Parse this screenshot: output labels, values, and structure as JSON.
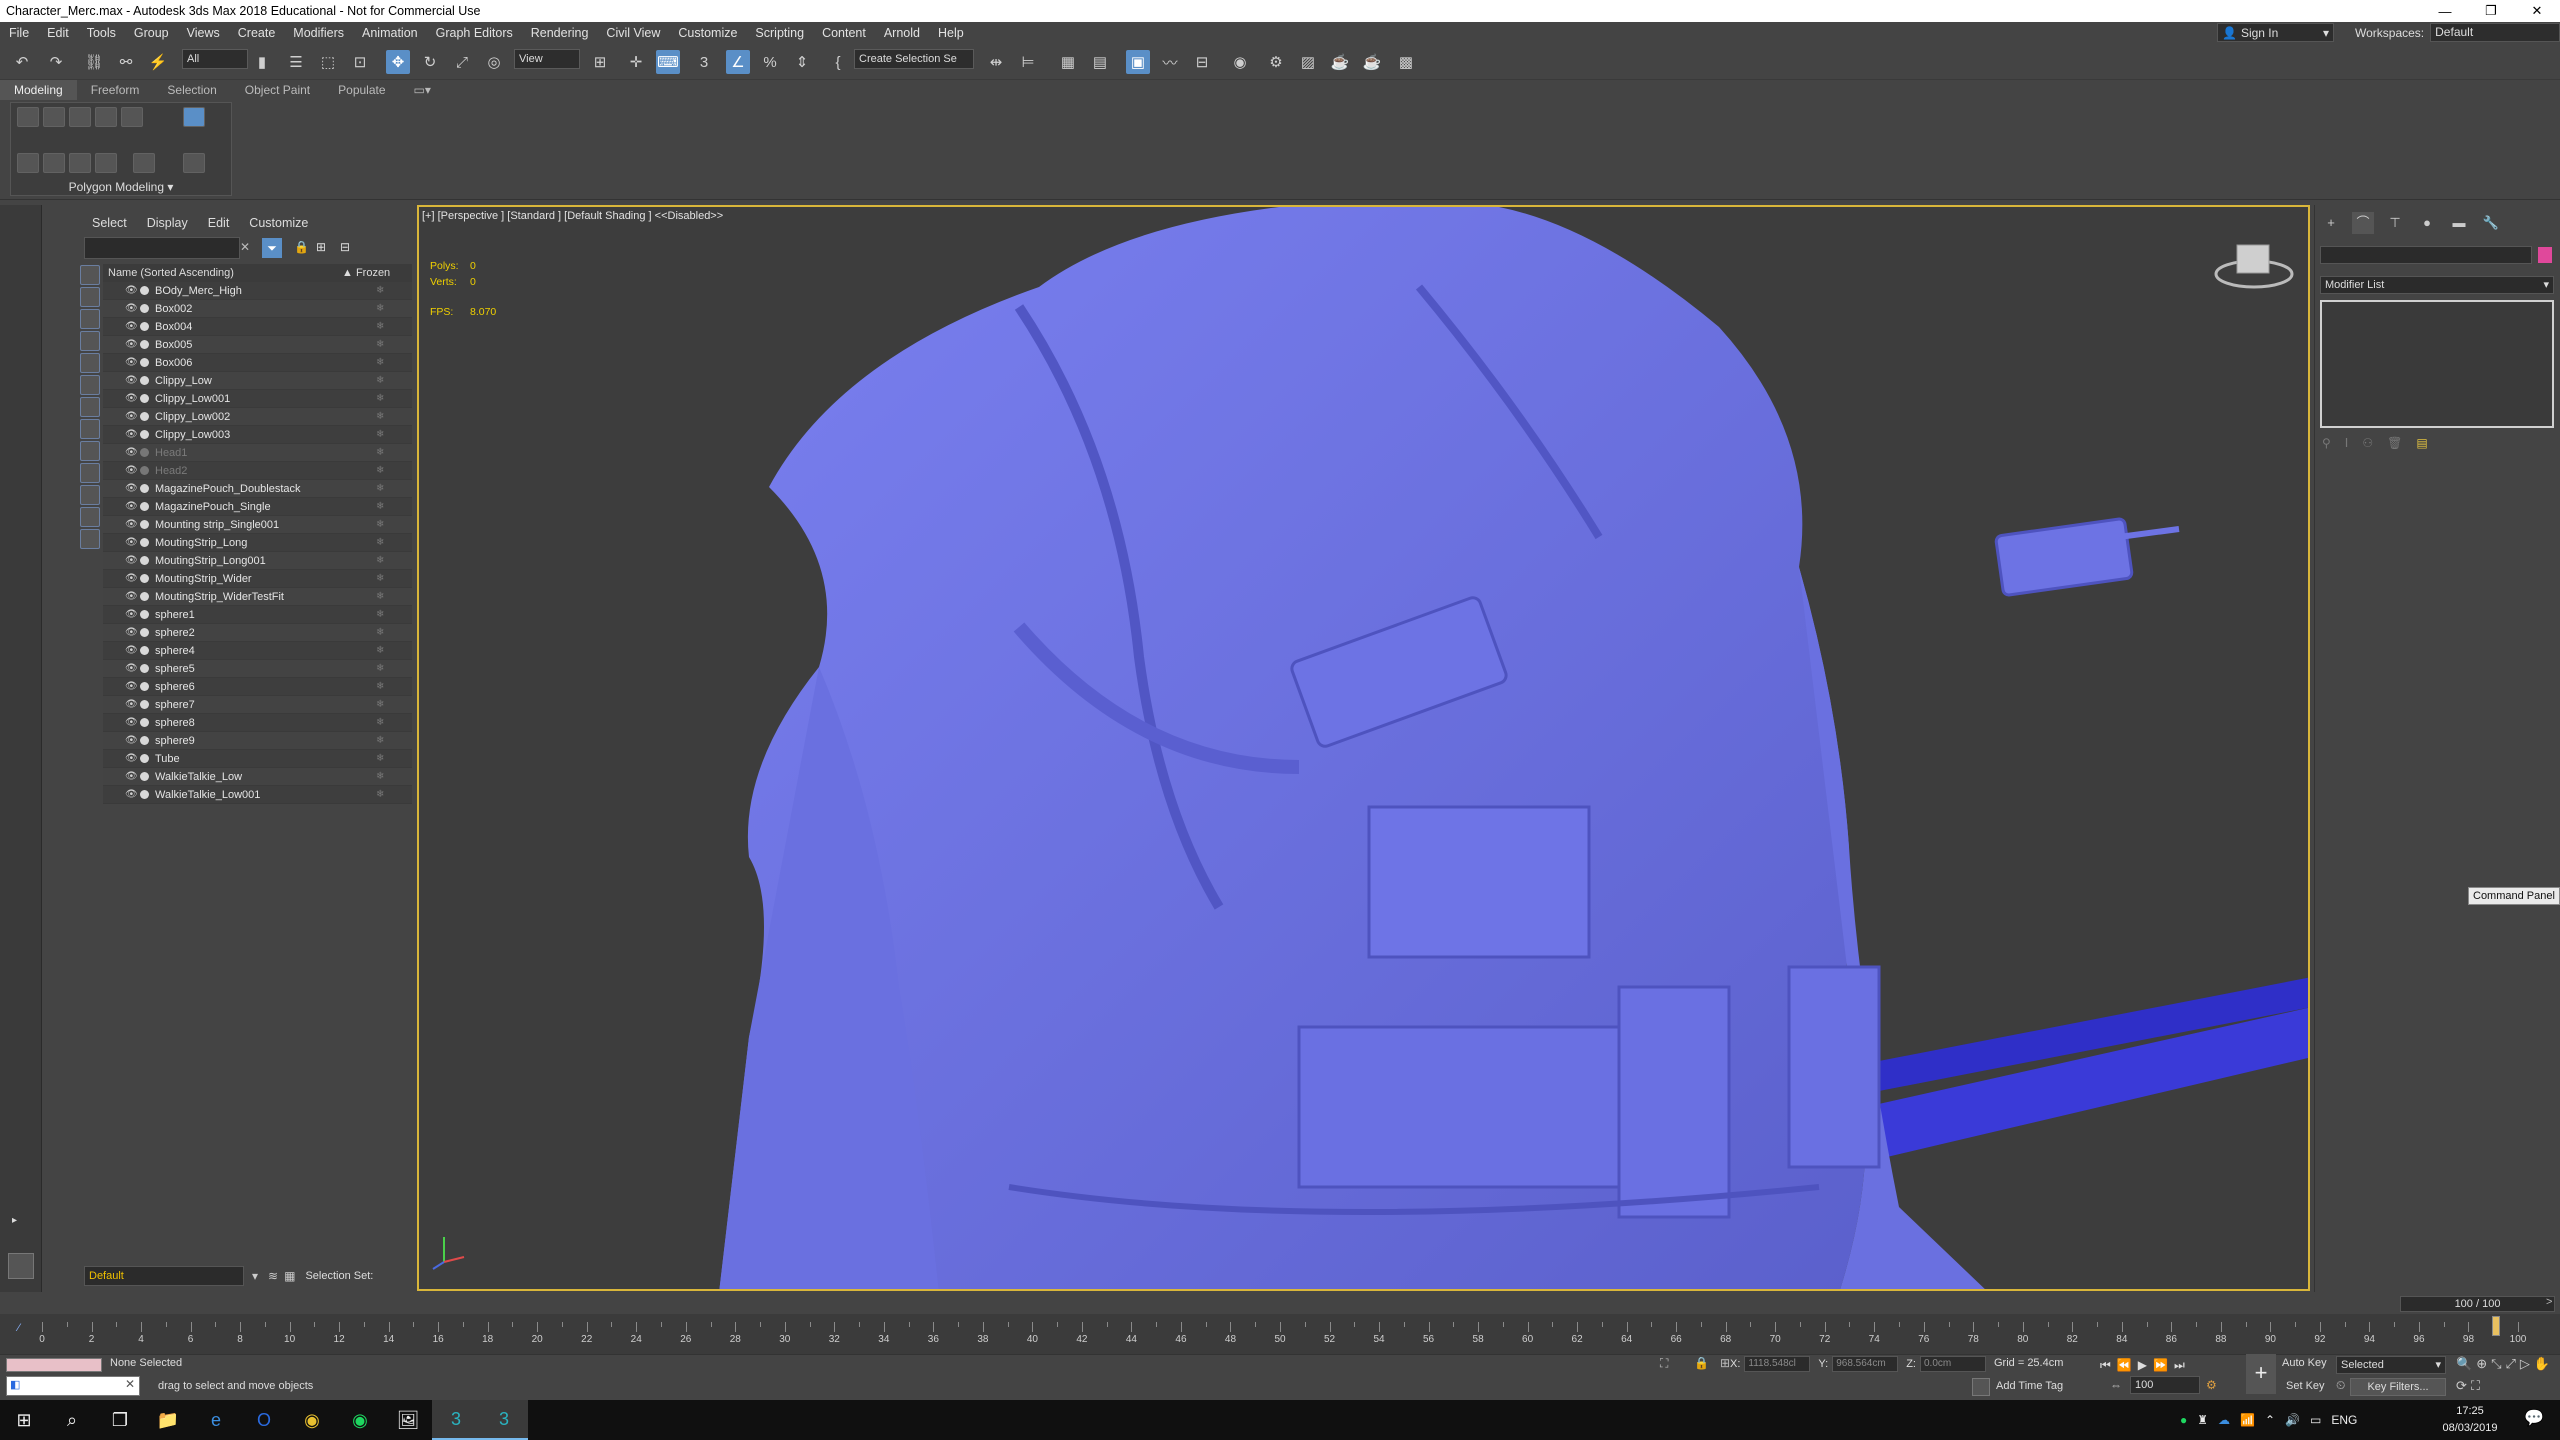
{
  "window": {
    "title": "Character_Merc.max - Autodesk 3ds Max 2018 Educational - Not for Commercial Use"
  },
  "menus": [
    "File",
    "Edit",
    "Tools",
    "Group",
    "Views",
    "Create",
    "Modifiers",
    "Animation",
    "Graph Editors",
    "Rendering",
    "Civil View",
    "Customize",
    "Scripting",
    "Content",
    "Arnold",
    "Help"
  ],
  "account": {
    "signin": "Sign In",
    "workspaces_label": "Workspaces:",
    "workspace": "Default"
  },
  "toolbar": {
    "filter": "All",
    "refcoord": "View",
    "selset": "Create Selection Se"
  },
  "ribbon": {
    "tabs": [
      "Modeling",
      "Freeform",
      "Selection",
      "Object Paint",
      "Populate"
    ],
    "panel": "Polygon Modeling"
  },
  "explorer": {
    "menus": [
      "Select",
      "Display",
      "Edit",
      "Customize"
    ],
    "col_name": "Name (Sorted Ascending)",
    "col_frozen": "▲ Frozen",
    "objects": [
      {
        "name": "BOdy_Merc_High"
      },
      {
        "name": "Box002"
      },
      {
        "name": "Box004"
      },
      {
        "name": "Box005"
      },
      {
        "name": "Box006"
      },
      {
        "name": "Clippy_Low"
      },
      {
        "name": "Clippy_Low001"
      },
      {
        "name": "Clippy_Low002"
      },
      {
        "name": "Clippy_Low003"
      },
      {
        "name": "Head1",
        "hidden": true
      },
      {
        "name": "Head2",
        "hidden": true
      },
      {
        "name": "MagazinePouch_Doublestack"
      },
      {
        "name": "MagazinePouch_Single"
      },
      {
        "name": "Mounting strip_Single001"
      },
      {
        "name": "MoutingStrip_Long"
      },
      {
        "name": "MoutingStrip_Long001"
      },
      {
        "name": "MoutingStrip_Wider"
      },
      {
        "name": "MoutingStrip_WiderTestFit"
      },
      {
        "name": "sphere1"
      },
      {
        "name": "sphere2"
      },
      {
        "name": "sphere4"
      },
      {
        "name": "sphere5"
      },
      {
        "name": "sphere6"
      },
      {
        "name": "sphere7"
      },
      {
        "name": "sphere8"
      },
      {
        "name": "sphere9"
      },
      {
        "name": "Tube"
      },
      {
        "name": "WalkieTalkie_Low"
      },
      {
        "name": "WalkieTalkie_Low001"
      }
    ],
    "layer": "Default",
    "selection_set": "Selection Set:"
  },
  "viewport": {
    "label": "[+] [Perspective ] [Standard ] [Default Shading ]  <<Disabled>>",
    "polys_label": "Polys:",
    "polys": "0",
    "verts_label": "Verts:",
    "verts": "0",
    "fps_label": "FPS:",
    "fps": "8.070",
    "model_color": "#7076e8"
  },
  "command_panel": {
    "modifier_list": "Modifier List",
    "tooltip": "Command Panel",
    "object_color": "#e0489b"
  },
  "timeline": {
    "slider": "100 / 100",
    "ticks": [
      0,
      2,
      4,
      6,
      8,
      10,
      12,
      14,
      16,
      18,
      20,
      22,
      24,
      26,
      28,
      30,
      32,
      34,
      36,
      38,
      40,
      42,
      44,
      46,
      48,
      50,
      52,
      54,
      56,
      58,
      60,
      62,
      64,
      66,
      68,
      70,
      72,
      74,
      76,
      78,
      80,
      82,
      84,
      86,
      88,
      90,
      92,
      94,
      96,
      98,
      100
    ]
  },
  "status": {
    "selection": "None Selected",
    "hint": "drag to select and move objects",
    "x_label": "X:",
    "x": "1118.548cl",
    "y_label": "Y:",
    "y": "968.564cm",
    "z_label": "Z:",
    "z": "0.0cm",
    "grid": "Grid = 25.4cm",
    "add_time_tag": "Add Time Tag",
    "frame": "100",
    "auto_key": "Auto Key",
    "set_key": "Set Key",
    "selected": "Selected",
    "key_filters": "Key Filters..."
  },
  "taskbar": {
    "lang": "ENG",
    "time": "17:25",
    "date": "08/03/2019"
  }
}
